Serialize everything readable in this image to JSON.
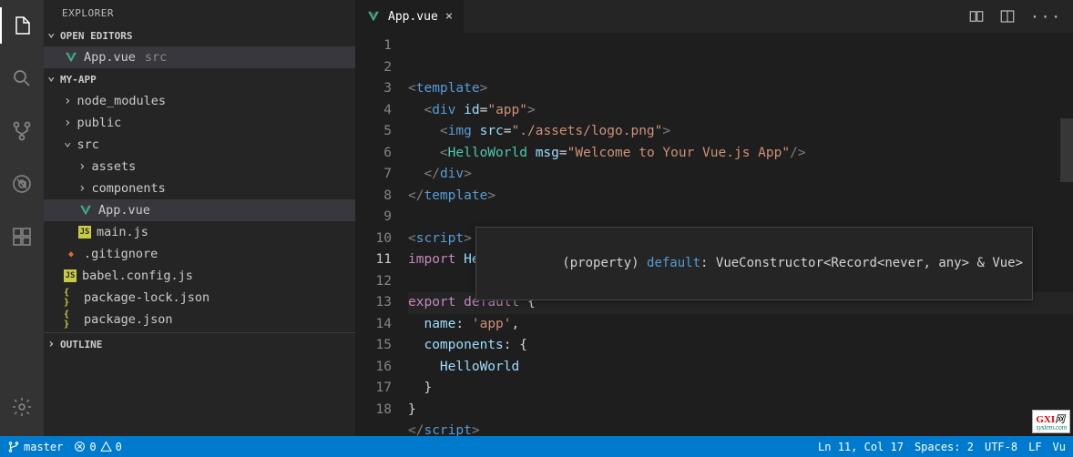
{
  "sidebar": {
    "title": "EXPLORER",
    "sections": {
      "openEditors": "OPEN EDITORS",
      "project": "MY-APP",
      "outline": "OUTLINE"
    },
    "openEditor": {
      "name": "App.vue",
      "path": "src"
    },
    "tree": [
      {
        "name": "node_modules",
        "type": "folder",
        "open": false,
        "indent": 1
      },
      {
        "name": "public",
        "type": "folder",
        "open": false,
        "indent": 1
      },
      {
        "name": "src",
        "type": "folder",
        "open": true,
        "indent": 1
      },
      {
        "name": "assets",
        "type": "folder",
        "open": false,
        "indent": 2
      },
      {
        "name": "components",
        "type": "folder",
        "open": false,
        "indent": 2
      },
      {
        "name": "App.vue",
        "type": "vue",
        "indent": 2,
        "selected": true
      },
      {
        "name": "main.js",
        "type": "js",
        "indent": 2
      },
      {
        "name": ".gitignore",
        "type": "git",
        "indent": 1
      },
      {
        "name": "babel.config.js",
        "type": "js",
        "indent": 1
      },
      {
        "name": "package-lock.json",
        "type": "json",
        "indent": 1
      },
      {
        "name": "package.json",
        "type": "json",
        "indent": 1
      }
    ]
  },
  "tab": {
    "name": "App.vue"
  },
  "code": {
    "lines": [
      {
        "n": 1,
        "html": "<span class='tok-tag'>&lt;</span><span class='tok-elem'>template</span><span class='tok-tag'>&gt;</span>"
      },
      {
        "n": 2,
        "html": "  <span class='tok-tag'>&lt;</span><span class='tok-elem'>div</span> <span class='tok-attr'>id</span><span class='tok-pun'>=</span><span class='tok-str'>\"app\"</span><span class='tok-tag'>&gt;</span>"
      },
      {
        "n": 3,
        "html": "    <span class='tok-tag'>&lt;</span><span class='tok-elem'>img</span> <span class='tok-attr'>src</span><span class='tok-pun'>=</span><span class='tok-str'>\"./assets/logo.png\"</span><span class='tok-tag'>&gt;</span>"
      },
      {
        "n": 4,
        "html": "    <span class='tok-tag'>&lt;</span><span class='tok-func'>HelloWorld</span> <span class='tok-attr'>msg</span><span class='tok-pun'>=</span><span class='tok-str'>\"Welcome to Your Vue.js App\"</span><span class='tok-tag'>/&gt;</span>"
      },
      {
        "n": 5,
        "html": "  <span class='tok-tag'>&lt;/</span><span class='tok-elem'>div</span><span class='tok-tag'>&gt;</span>"
      },
      {
        "n": 6,
        "html": "<span class='tok-tag'>&lt;/</span><span class='tok-elem'>template</span><span class='tok-tag'>&gt;</span>"
      },
      {
        "n": 7,
        "html": ""
      },
      {
        "n": 8,
        "html": "<span class='tok-tag'>&lt;</span><span class='tok-elem'>script</span><span class='tok-tag'>&gt;</span>"
      },
      {
        "n": 9,
        "html": "<span class='tok-kw'>import</span> <span class='tok-var'>HelloWorld</span> <span class='tok-kw'>from</span> <span class='tok-str'>'./components/HelloWorld.vue'</span>"
      },
      {
        "n": 10,
        "html": ""
      },
      {
        "n": 11,
        "html": "<span class='tok-kw'>export</span> <span class='tok-kw'>default</span> <span class='tok-pun'>{</span>",
        "current": true
      },
      {
        "n": 12,
        "html": "  <span class='tok-prop'>name</span><span class='tok-pun'>:</span> <span class='tok-str'>'app'</span><span class='tok-pun'>,</span>"
      },
      {
        "n": 13,
        "html": "  <span class='tok-prop'>components</span><span class='tok-pun'>:</span> <span class='tok-pun'>{</span>"
      },
      {
        "n": 14,
        "html": "    <span class='tok-var'>HelloWorld</span>"
      },
      {
        "n": 15,
        "html": "  <span class='tok-pun'>}</span>"
      },
      {
        "n": 16,
        "html": "<span class='tok-pun'>}</span>"
      },
      {
        "n": 17,
        "html": "<span class='tok-tag'>&lt;/</span><span class='tok-elem'>script</span><span class='tok-tag'>&gt;</span>"
      },
      {
        "n": 18,
        "html": ""
      }
    ]
  },
  "hover": {
    "text_prefix": "(property) ",
    "text_kw": "default",
    "text_suffix": ": VueConstructor<Record<never, any> & Vue>"
  },
  "status": {
    "branch": "master",
    "errors": "0",
    "warnings": "0",
    "cursor": "Ln 11, Col 17",
    "spaces": "Spaces: 2",
    "encoding": "UTF-8",
    "eol": "LF",
    "lang": "Vu"
  },
  "watermark": {
    "brand": "GXI",
    "suffix": "网",
    "sub": "system.com"
  }
}
